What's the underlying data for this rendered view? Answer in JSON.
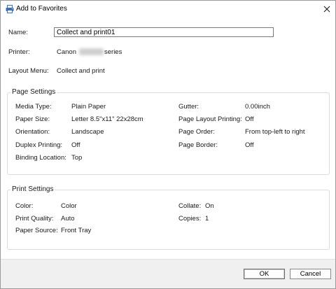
{
  "dialog": {
    "title": "Add to Favorites",
    "icons": {
      "app": "printer-icon",
      "close": "close-icon"
    }
  },
  "fields": {
    "name_label": "Name:",
    "name_value": "Collect and print01",
    "printer_label": "Printer:",
    "printer_value_prefix": "Canon",
    "printer_value_suffix": "series",
    "layout_menu_label": "Layout Menu:",
    "layout_menu_value": "Collect and print"
  },
  "page_settings": {
    "title": "Page Settings",
    "left": [
      {
        "label": "Media Type:",
        "value": "Plain Paper"
      },
      {
        "label": "Paper Size:",
        "value": "Letter 8.5\"x11\" 22x28cm"
      },
      {
        "label": "Orientation:",
        "value": "Landscape"
      },
      {
        "label": "Duplex Printing:",
        "value": "Off"
      },
      {
        "label": "Binding Location:",
        "value": "Top"
      }
    ],
    "right": [
      {
        "label": "Gutter:",
        "value": "0.00inch"
      },
      {
        "label": "Page Layout Printing:",
        "value": "Off"
      },
      {
        "label": "Page Order:",
        "value": "From top-left to right"
      },
      {
        "label": "Page Border:",
        "value": "Off"
      }
    ]
  },
  "print_settings": {
    "title": "Print Settings",
    "left": [
      {
        "label": "Color:",
        "value": "Color"
      },
      {
        "label": "Print Quality:",
        "value": "Auto"
      },
      {
        "label": "Paper Source:",
        "value": "Front Tray"
      }
    ],
    "right": [
      {
        "label": "Collate:",
        "value": "On"
      },
      {
        "label": "Copies:",
        "value": "1"
      }
    ]
  },
  "buttons": {
    "ok": "OK",
    "cancel": "Cancel"
  }
}
